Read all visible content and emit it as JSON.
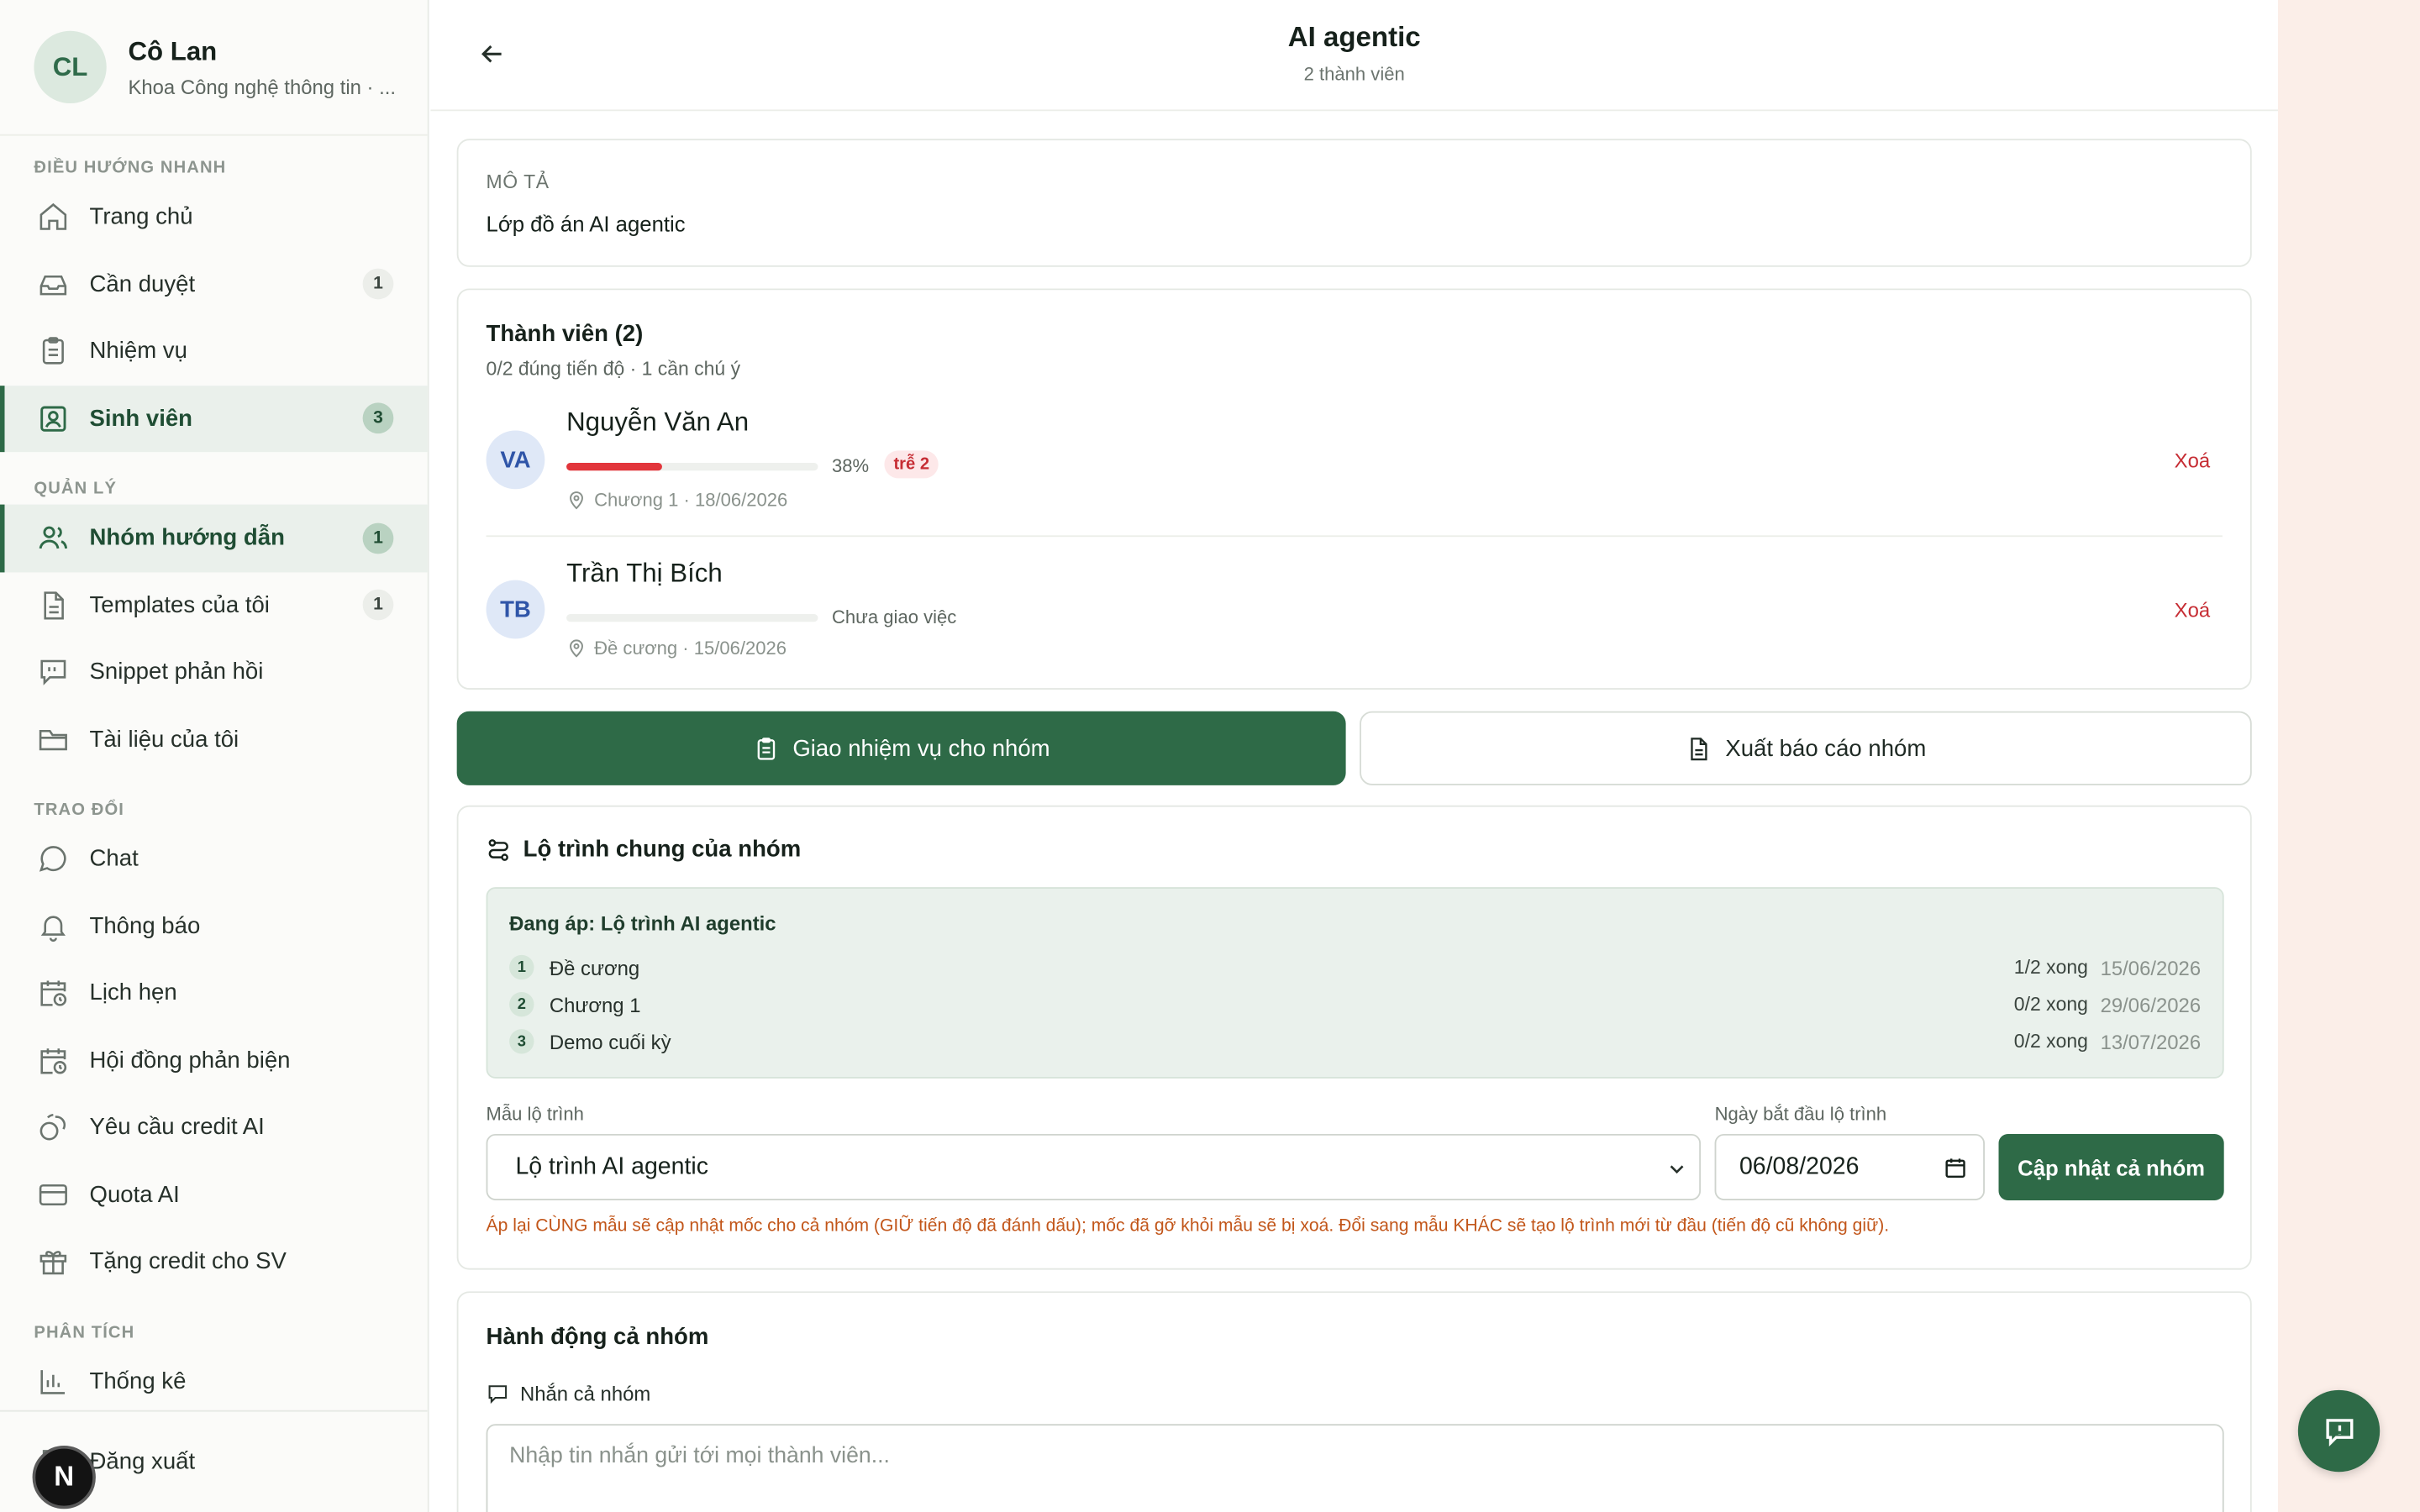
{
  "profile": {
    "initials": "CL",
    "name": "Cô Lan",
    "subtitle": "Khoa Công nghệ thông tin · ..."
  },
  "sidebar": {
    "sections": {
      "quick": "ĐIỀU HƯỚNG NHANH",
      "manage": "QUẢN LÝ",
      "exchange": "TRAO ĐỔI",
      "analytics": "PHÂN TÍCH"
    },
    "items": [
      {
        "label": "Trang chủ",
        "icon": "home-icon"
      },
      {
        "label": "Cần duyệt",
        "icon": "inbox-icon",
        "badge": "1"
      },
      {
        "label": "Nhiệm vụ",
        "icon": "clipboard-icon"
      },
      {
        "label": "Sinh viên",
        "icon": "student-icon",
        "badge": "3",
        "active": true
      },
      {
        "label": "Nhóm hướng dẫn",
        "icon": "users-icon",
        "badge": "1",
        "active": true
      },
      {
        "label": "Templates của tôi",
        "icon": "file-icon",
        "badge": "1"
      },
      {
        "label": "Snippet phản hồi",
        "icon": "snippet-icon"
      },
      {
        "label": "Tài liệu của tôi",
        "icon": "folder-icon"
      },
      {
        "label": "Chat",
        "icon": "chat-icon"
      },
      {
        "label": "Thông báo",
        "icon": "bell-icon"
      },
      {
        "label": "Lịch hẹn",
        "icon": "calendar-clock-icon"
      },
      {
        "label": "Hội đồng phản biện",
        "icon": "calendar-clock-icon"
      },
      {
        "label": "Yêu cầu credit AI",
        "icon": "coins-icon"
      },
      {
        "label": "Quota AI",
        "icon": "card-icon"
      },
      {
        "label": "Tặng credit cho SV",
        "icon": "gift-icon"
      },
      {
        "label": "Thống kê",
        "icon": "chart-icon"
      },
      {
        "label": "Đăng xuất",
        "icon": "logout-icon"
      }
    ],
    "bubble_letter": "N"
  },
  "header": {
    "title": "AI agentic",
    "subtitle": "2 thành viên"
  },
  "description": {
    "label": "MÔ TẢ",
    "text": "Lớp đồ án AI agentic"
  },
  "members": {
    "title": "Thành viên (2)",
    "summary": "0/2 đúng tiến độ · 1 cần chú ý",
    "list": [
      {
        "initials": "VA",
        "name": "Nguyễn Văn An",
        "progress": 0.38,
        "progress_text": "38%",
        "late_badge": "trễ 2",
        "meta": "Chương 1 · 18/06/2026",
        "remove": "Xoá"
      },
      {
        "initials": "TB",
        "name": "Trần Thị Bích",
        "progress": 0,
        "progress_text": "Chưa giao việc",
        "meta": "Đề cương · 15/06/2026",
        "remove": "Xoá"
      }
    ]
  },
  "actions": {
    "assign": "Giao nhiệm vụ cho nhóm",
    "export": "Xuất báo cáo nhóm"
  },
  "roadmap": {
    "title": "Lộ trình chung của nhóm",
    "applied": "Đang áp: Lộ trình AI agentic",
    "steps": [
      {
        "num": "1",
        "name": "Đề cương",
        "done": "1/2 xong",
        "date": "15/06/2026"
      },
      {
        "num": "2",
        "name": "Chương 1",
        "done": "0/2 xong",
        "date": "29/06/2026"
      },
      {
        "num": "3",
        "name": "Demo cuối kỳ",
        "done": "0/2 xong",
        "date": "13/07/2026"
      }
    ],
    "template_label": "Mẫu lộ trình",
    "template_value": "Lộ trình AI agentic",
    "start_label": "Ngày bắt đầu lộ trình",
    "start_value": "06/08/2026",
    "update_button": "Cập nhật cả nhóm",
    "warning": "Áp lại CÙNG mẫu sẽ cập nhật mốc cho cả nhóm (GIỮ tiến độ đã đánh dấu); mốc đã gỡ khỏi mẫu sẽ bị xoá. Đổi sang mẫu KHÁC sẽ tạo lộ trình mới từ đầu (tiến độ cũ không giữ)."
  },
  "group_actions": {
    "title": "Hành động cả nhóm",
    "message_label": "Nhắn cả nhóm",
    "message_placeholder": "Nhập tin nhắn gửi tới mọi thành viên..."
  },
  "colors": {
    "primary": "#2e6a47",
    "danger": "#c62d34",
    "warning": "#c2561a"
  }
}
